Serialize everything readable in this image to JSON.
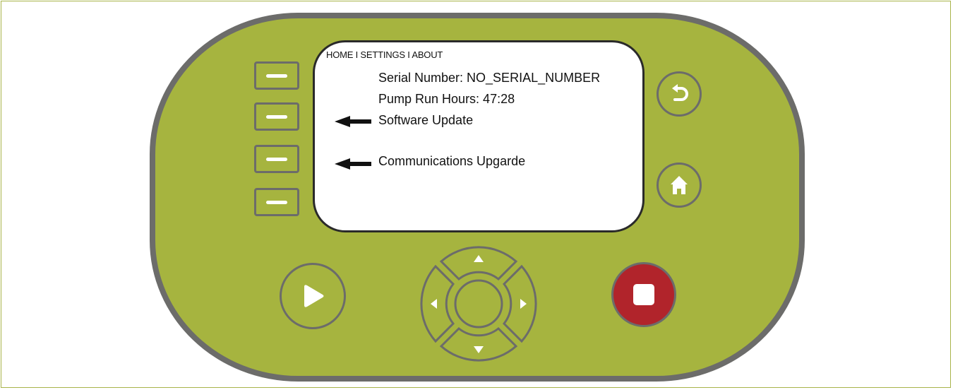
{
  "screen": {
    "breadcrumb": "HOME I SETTINGS I ABOUT",
    "serial_line": "Serial Number: NO_SERIAL_NUMBER",
    "hours_line": "Pump Run Hours: 47:28",
    "menu_items": [
      {
        "label": "Software Update",
        "icon": "arrow-left-icon"
      },
      {
        "label": "Communications Upgarde",
        "icon": "arrow-left-icon"
      }
    ]
  },
  "colors": {
    "body": "#a6b43f",
    "border": "#6c6c6a",
    "stop": "#b1242b"
  },
  "buttons": {
    "softkeys": [
      "softkey-1",
      "softkey-2",
      "softkey-3",
      "softkey-4"
    ],
    "back": "back-icon",
    "home": "home-icon",
    "play": "play-icon",
    "stop": "stop-icon",
    "dpad": [
      "up-arrow-icon",
      "down-arrow-icon",
      "left-arrow-icon",
      "right-arrow-icon"
    ]
  }
}
